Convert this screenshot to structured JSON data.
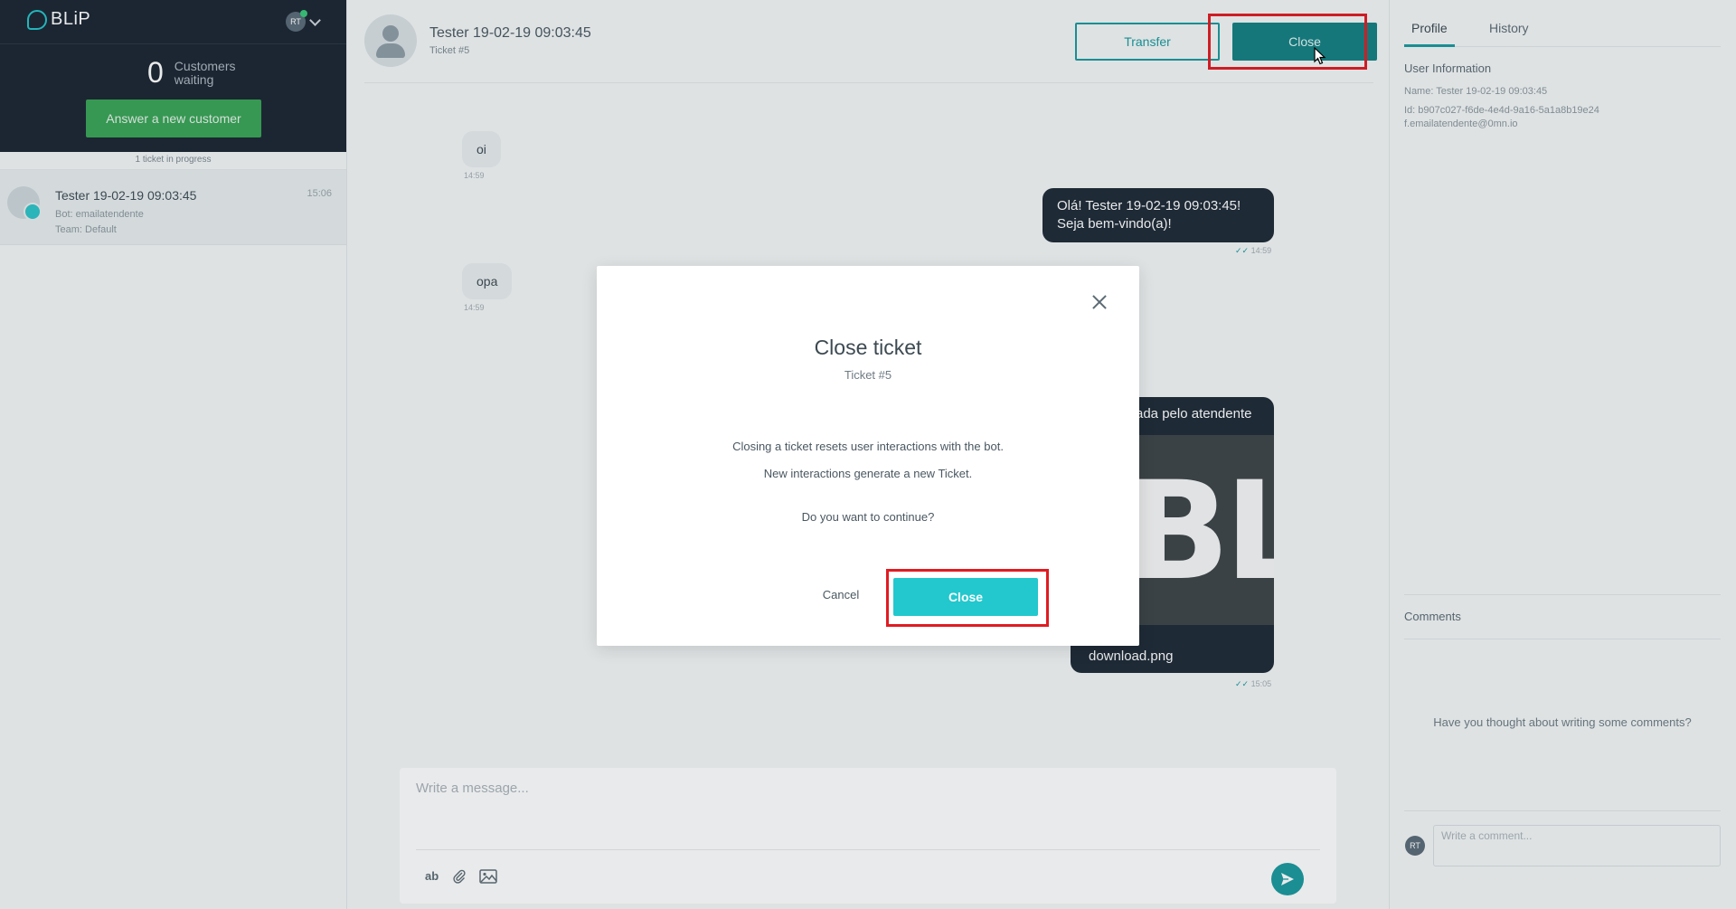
{
  "brand": {
    "name": "BLiP"
  },
  "agent": {
    "initials": "RT"
  },
  "queue": {
    "waiting_count": "0",
    "waiting_label": "Customers waiting",
    "answer_button": "Answer a new customer",
    "in_progress": "1 ticket in progress"
  },
  "tickets": [
    {
      "name": "Tester 19-02-19 09:03:45",
      "time": "15:06",
      "bot": "Bot: emailatendente",
      "team": "Team: Default"
    }
  ],
  "chat": {
    "customer_name": "Tester 19-02-19 09:03:45",
    "ticket_label": "Ticket #5",
    "transfer_button": "Transfer",
    "close_button": "Close",
    "messages": [
      {
        "direction": "in",
        "text": "oi",
        "time": "14:59"
      },
      {
        "direction": "out",
        "line1": "Olá! Tester 19-02-19 09:03:45!",
        "line2": "Seja bem-vindo(a)!",
        "time": "14:59"
      },
      {
        "direction": "in",
        "text": "opa",
        "time": "14:59"
      },
      {
        "direction": "out",
        "caption": "ada pelo atendente",
        "image_text": "BL",
        "file_name": "download.png",
        "time": "15:05"
      }
    ],
    "composer_placeholder": "Write a message...",
    "tools": {
      "text_format": "ab"
    }
  },
  "profile": {
    "tabs": [
      "Profile",
      "History"
    ],
    "user_info_heading": "User Information",
    "name_line": "Name: Tester 19-02-19 09:03:45",
    "id_line": "Id: b907c027-f6de-4e4d-9a16-5a1a8b19e24f.emailatendente@0mn.io",
    "comments_heading": "Comments",
    "comments_empty": "Have you thought about writing some comments?",
    "comment_placeholder": "Write a comment..."
  },
  "modal": {
    "title": "Close ticket",
    "subtitle": "Ticket #5",
    "line1": "Closing a ticket resets user interactions with the bot.",
    "line2": "New interactions generate a new Ticket.",
    "question": "Do you want to continue?",
    "cancel": "Cancel",
    "confirm": "Close"
  },
  "colors": {
    "accent": "#19999e",
    "close_dark": "#137f82",
    "modal_confirm": "#22c8cd",
    "answer_green": "#38a455",
    "sidebar_dark": "#1b2532",
    "highlight_red": "#e11b22"
  }
}
